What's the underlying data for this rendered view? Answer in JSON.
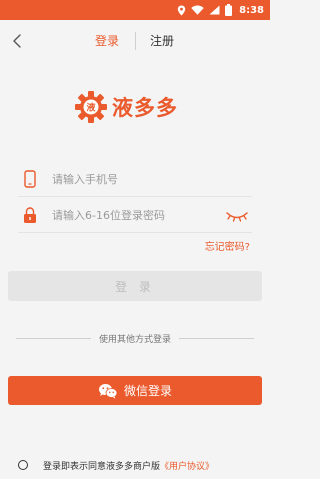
{
  "status_bar": {
    "time": "8:38",
    "accent": "#ea5a2c"
  },
  "nav": {
    "tabs": [
      {
        "label": "登录",
        "active": true
      },
      {
        "label": "注册",
        "active": false
      }
    ]
  },
  "logo": {
    "text": "液多多",
    "badge": "液"
  },
  "form": {
    "phone_placeholder": "请输入手机号",
    "password_placeholder": "请输入6-16位登录密码",
    "forgot_label": "忘记密码?",
    "login_label": "登 录"
  },
  "alt_login": {
    "divider_text": "使用其他方式登录",
    "wechat_label": "微信登录"
  },
  "agreement": {
    "text": "登录即表示同意液多多商户版",
    "link": "《用户协议》"
  },
  "icons": [
    "location-icon",
    "wifi-icon",
    "signal-icon",
    "battery-icon",
    "back-arrow-icon",
    "phone-icon",
    "lock-icon",
    "eye-closed-icon",
    "wechat-icon"
  ]
}
